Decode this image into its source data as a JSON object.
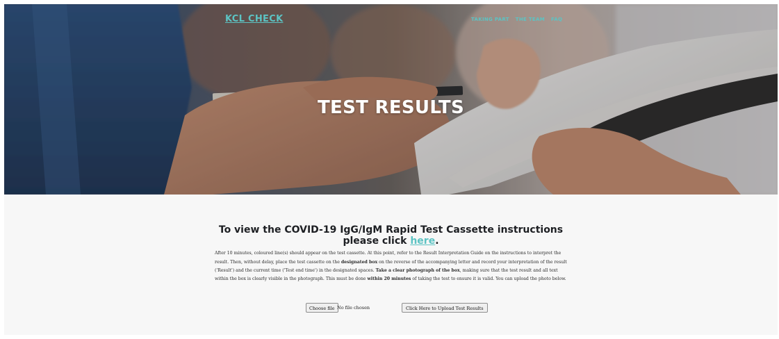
{
  "header": {
    "brand": "KCL CHECK",
    "nav": [
      "TAKING PART",
      "THE TEAM",
      "FAQ"
    ]
  },
  "hero": {
    "title": "TEST RESULTS"
  },
  "main": {
    "heading_text": "To view the COVID-19 IgG/IgM Rapid Test Cassette instructions please click",
    "heading_link": "here",
    "heading_end": ".",
    "paragraph": {
      "t1": "After 10 minutes, coloured line(s) should appear on the test cassette. At this point, refer to the Result Interpretation Guide on the instructions to interpret the result. Then, without delay, place the test cassette on the ",
      "b1": "designated box",
      "t2": " on the reverse of the accompanying letter and record your interpretation of the result ('Result') and the current time ('Test end time') in the designated spaces. ",
      "b2": "Take a clear photograph of the box",
      "t3": ", making sure that the test result and all text within the box is clearly visible in the photograph. This must be done ",
      "b3": "within 20 minutes",
      "t4": " of taking the test to ensure it is valid. You can upload the photo below."
    },
    "upload": {
      "choose_file_label": "Choose file",
      "file_status": "No file chosen",
      "upload_button_label": "Click Here to Upload Test Results"
    }
  },
  "colors": {
    "accent": "#5cc3c3",
    "content_bg": "#f7f7f7",
    "heading_text": "#1d1f23"
  }
}
